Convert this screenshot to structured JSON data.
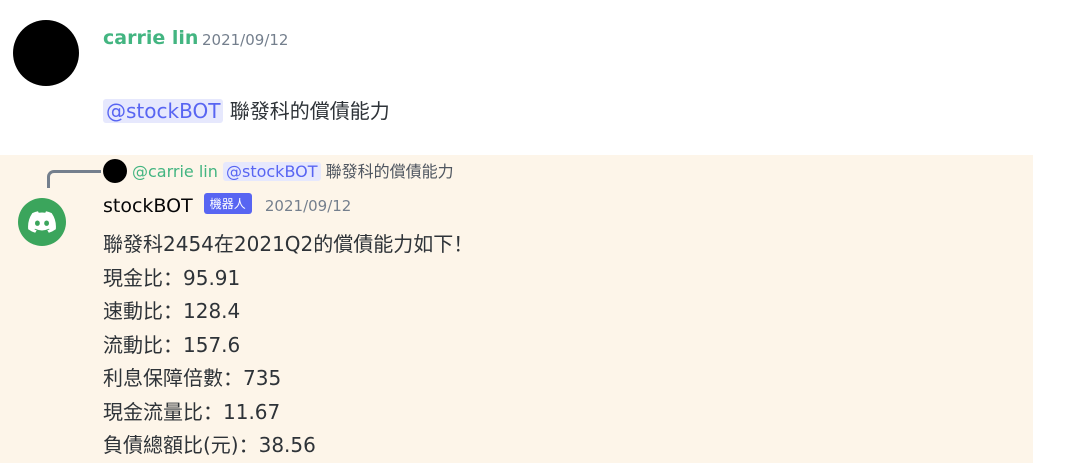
{
  "message1": {
    "username": "carrie lin",
    "timestamp": "2021/09/12",
    "mention": "@stockBOT",
    "text": "聯發科的償債能力"
  },
  "reply": {
    "username": "@carrie lin",
    "mention": "@stockBOT",
    "text": "聯發科的償債能力"
  },
  "message2": {
    "username": "stockBOT",
    "badge": "機器人",
    "timestamp": "2021/09/12",
    "lines": [
      "聯發科2454在2021Q2的償債能力如下！",
      "現金比：95.91",
      "速動比：128.4",
      "流動比：157.6",
      "利息保障倍數：735",
      "現金流量比：11.67",
      "負債總額比(元)：38.56"
    ]
  },
  "colors": {
    "username_green": "#43b581",
    "mention_blue": "#5865f2",
    "highlight_bg": "#fdf5e9",
    "bot_avatar": "#3ba55c"
  }
}
